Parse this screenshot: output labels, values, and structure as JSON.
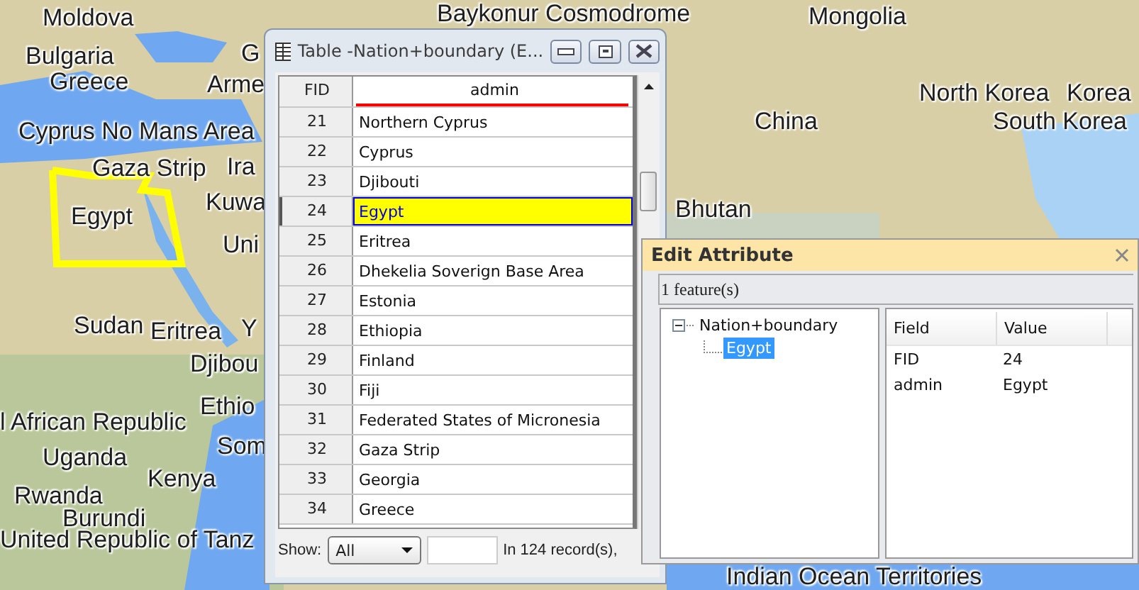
{
  "map": {
    "labels": [
      {
        "text": "Moldova"
      },
      {
        "text": "Bulgaria"
      },
      {
        "text": "Greece"
      },
      {
        "text": "G"
      },
      {
        "text": "Arme"
      },
      {
        "text": "Cyprus No Mans Area"
      },
      {
        "text": "Gaza Strip"
      },
      {
        "text": "Ira"
      },
      {
        "text": "Egypt"
      },
      {
        "text": "Kuwa"
      },
      {
        "text": "Uni"
      },
      {
        "text": "Sudan"
      },
      {
        "text": "Eritrea"
      },
      {
        "text": "Y"
      },
      {
        "text": "Djibou"
      },
      {
        "text": "Ethio"
      },
      {
        "text": "l African Republic"
      },
      {
        "text": "Som"
      },
      {
        "text": "Uganda"
      },
      {
        "text": "Kenya"
      },
      {
        "text": "Rwanda"
      },
      {
        "text": "Burundi"
      },
      {
        "text": "United Republic of Tanz"
      },
      {
        "text": "Baykonur Cosmodrome"
      },
      {
        "text": "Mongolia"
      },
      {
        "text": "China"
      },
      {
        "text": "North Korea"
      },
      {
        "text": "Korea"
      },
      {
        "text": "South Korea"
      },
      {
        "text": "Bhutan"
      },
      {
        "text": "Indian Ocean Territories"
      }
    ]
  },
  "table_window": {
    "title": "Table -Nation+boundary (E...",
    "columns": [
      "FID",
      "admin"
    ],
    "rows": [
      {
        "fid": "21",
        "admin": "Northern Cyprus",
        "selected": false
      },
      {
        "fid": "22",
        "admin": "Cyprus",
        "selected": false
      },
      {
        "fid": "23",
        "admin": "Djibouti",
        "selected": false
      },
      {
        "fid": "24",
        "admin": "Egypt",
        "selected": true
      },
      {
        "fid": "25",
        "admin": "Eritrea",
        "selected": false
      },
      {
        "fid": "26",
        "admin": "Dhekelia Soverign Base Area",
        "selected": false
      },
      {
        "fid": "27",
        "admin": "Estonia",
        "selected": false
      },
      {
        "fid": "28",
        "admin": "Ethiopia",
        "selected": false
      },
      {
        "fid": "29",
        "admin": "Finland",
        "selected": false
      },
      {
        "fid": "30",
        "admin": "Fiji",
        "selected": false
      },
      {
        "fid": "31",
        "admin": "Federated States of Micronesia",
        "selected": false
      },
      {
        "fid": "32",
        "admin": "Gaza Strip",
        "selected": false
      },
      {
        "fid": "33",
        "admin": "Georgia",
        "selected": false
      },
      {
        "fid": "34",
        "admin": "Greece",
        "selected": false
      }
    ],
    "footer": {
      "show_label": "Show:",
      "show_value": "All",
      "records": "In 124 record(s),"
    }
  },
  "edit_attribute": {
    "title": "Edit Attribute",
    "count": "1 feature(s)",
    "tree": [
      {
        "label": "Nation+boundary",
        "expanded": true,
        "selected": false,
        "children": [
          {
            "label": "Egypt",
            "selected": true
          }
        ]
      }
    ],
    "columns": [
      "Field",
      "Value"
    ],
    "rows": [
      {
        "field": "FID",
        "value": "24"
      },
      {
        "field": "admin",
        "value": "Egypt"
      }
    ]
  }
}
